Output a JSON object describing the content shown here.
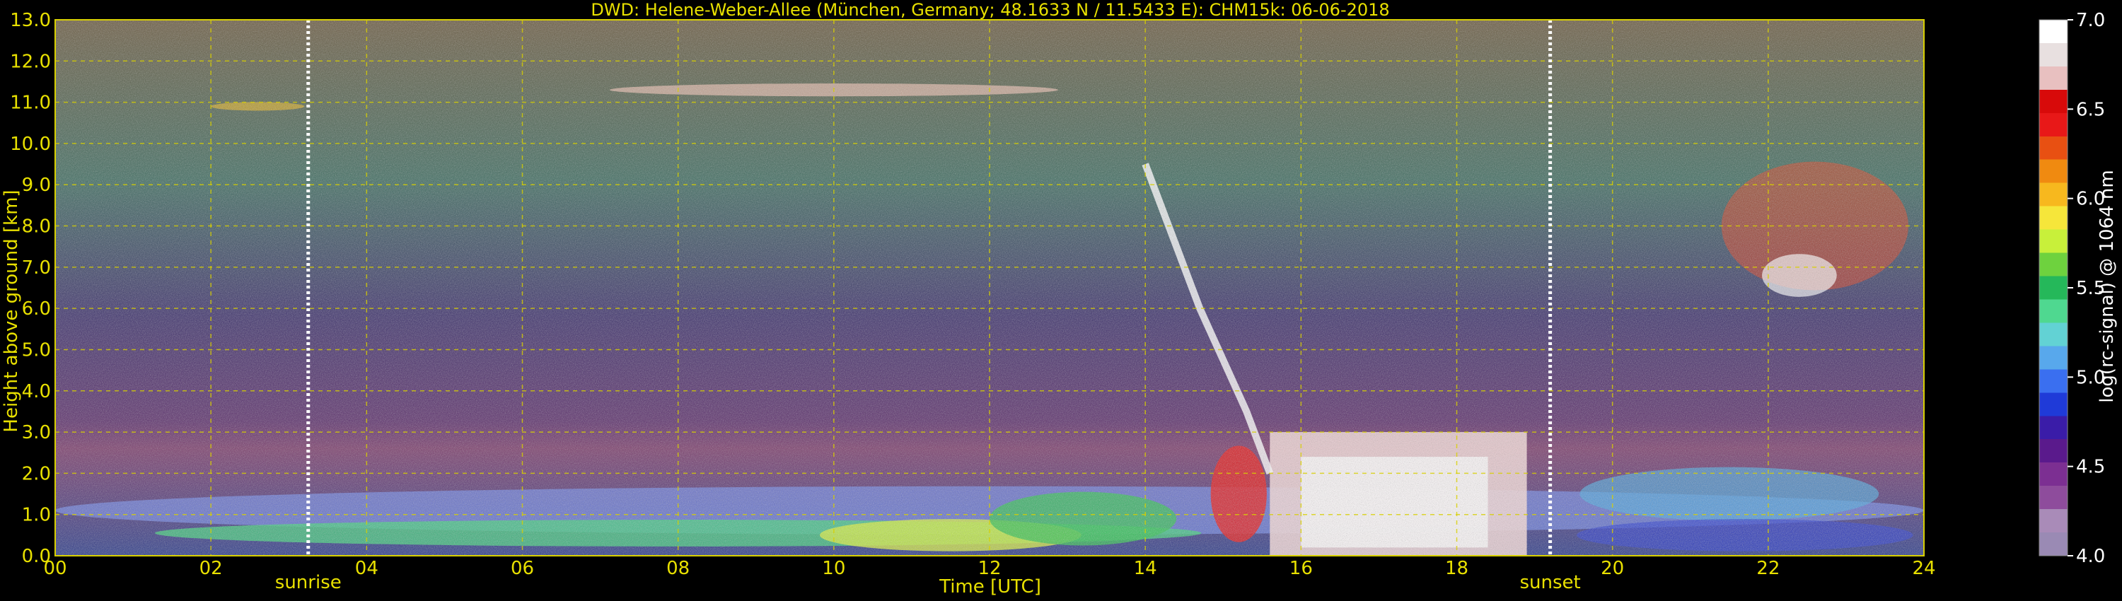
{
  "chart_data": {
    "type": "heatmap",
    "title": "DWD: Helene-Weber-Allee (München, Germany; 48.1633 N / 11.5433 E):    CHM15k: 06-06-2018",
    "xlabel": "Time [UTC]",
    "ylabel": "Height above ground [km]",
    "xlim": [
      0,
      24
    ],
    "ylim": [
      0,
      13
    ],
    "x_ticks": [
      "00",
      "02",
      "04",
      "06",
      "08",
      "10",
      "12",
      "14",
      "16",
      "18",
      "20",
      "22",
      "24"
    ],
    "y_ticks": [
      "0.0",
      "1.0",
      "2.0",
      "3.0",
      "4.0",
      "5.0",
      "6.0",
      "7.0",
      "8.0",
      "9.0",
      "10.0",
      "11.0",
      "12.0",
      "13.0"
    ],
    "grid": true,
    "colorbar": {
      "label": "log(rc-signal) @ 1064 nm",
      "range": [
        4.0,
        7.0
      ],
      "ticks": [
        "4.0",
        "4.5",
        "5.0",
        "5.5",
        "6.0",
        "6.5",
        "7.0"
      ],
      "colors": [
        "#9a8ab4",
        "#a98bb8",
        "#8e4c9c",
        "#7c2f92",
        "#5a1a8c",
        "#3a1ca8",
        "#1f3ad8",
        "#3a6ff0",
        "#58a8ec",
        "#62d2d4",
        "#4fd890",
        "#25b85a",
        "#6ed23e",
        "#c8f03a",
        "#f6e63a",
        "#f7b81e",
        "#f08a10",
        "#e85012",
        "#e81818",
        "#d80a0a",
        "#e8c0c0",
        "#e8e0e0",
        "#ffffff"
      ]
    },
    "annotations": [
      {
        "text": "sunrise",
        "x": 3.25
      },
      {
        "text": "sunset",
        "x": 19.2
      }
    ]
  }
}
